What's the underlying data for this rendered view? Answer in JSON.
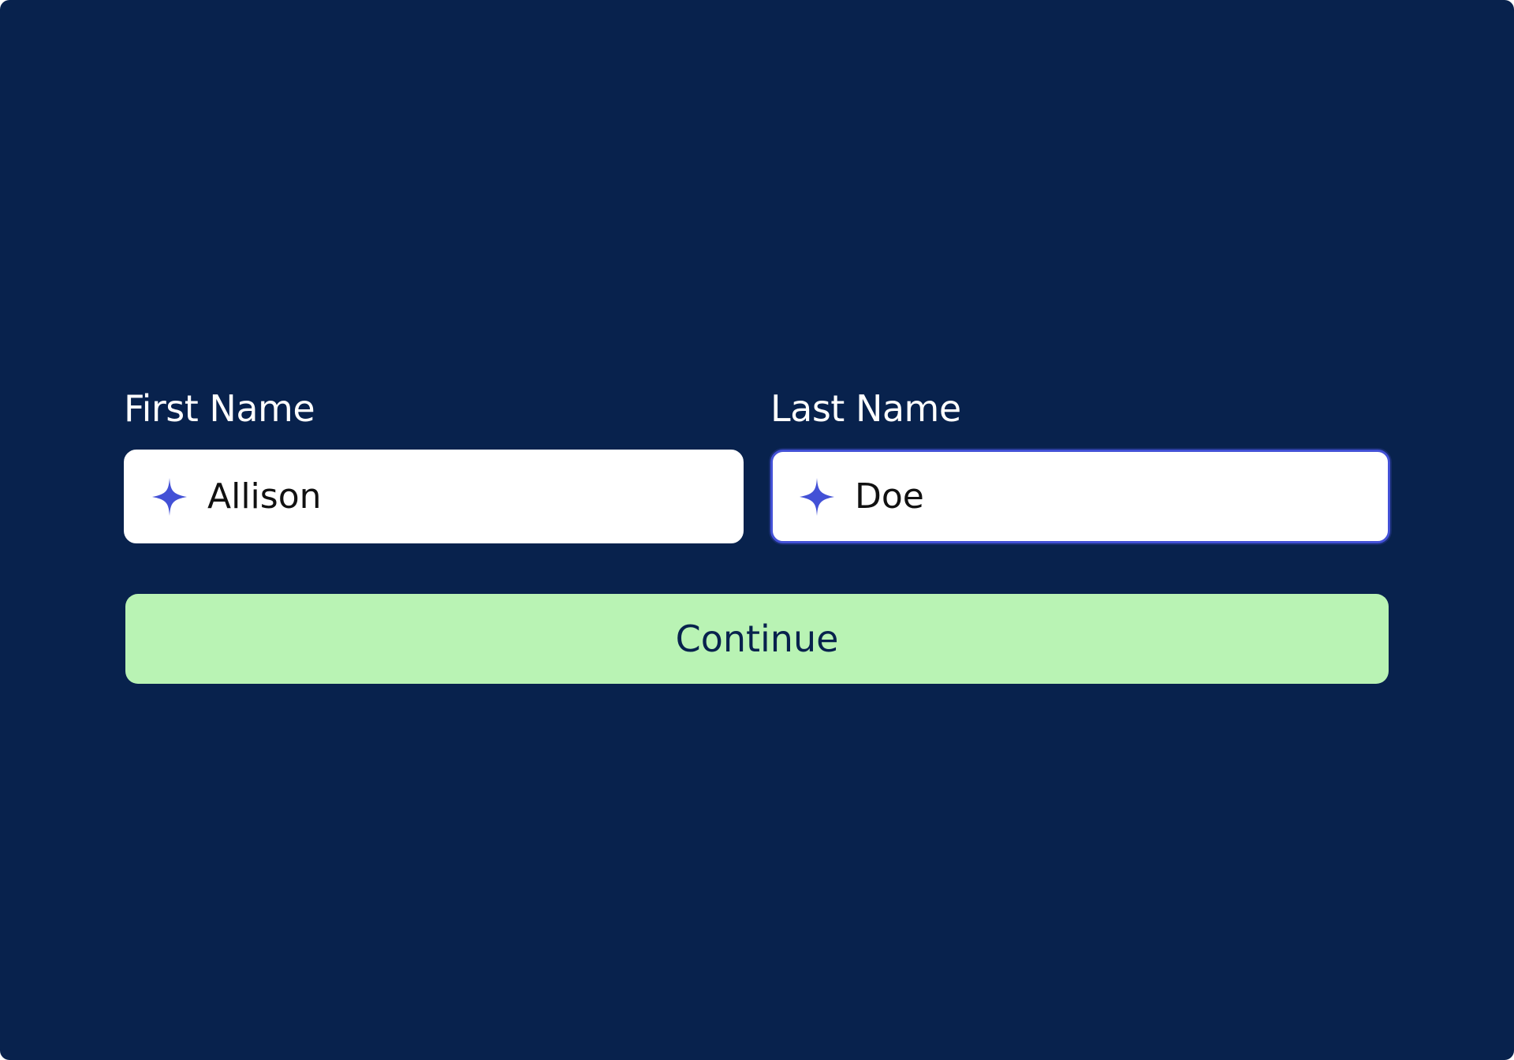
{
  "form": {
    "first_name": {
      "label": "First Name",
      "value": "Allison",
      "icon": "sparkle-icon"
    },
    "last_name": {
      "label": "Last Name",
      "value": "Doe",
      "icon": "sparkle-icon",
      "focused": true
    },
    "continue_label": "Continue"
  },
  "colors": {
    "background": "#08224d",
    "accent": "#4351d6",
    "button": "#b9f3b4",
    "button_text": "#08224d"
  }
}
